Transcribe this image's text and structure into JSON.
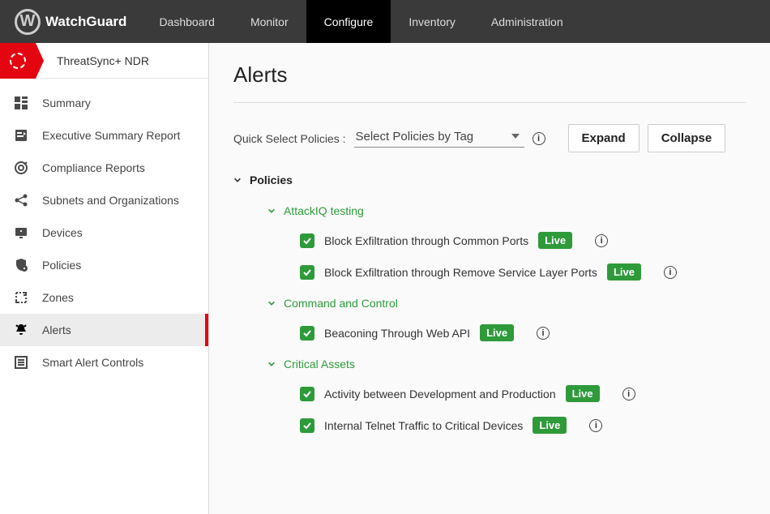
{
  "brand": "WatchGuard",
  "nav": {
    "items": [
      {
        "label": "Dashboard",
        "active": false
      },
      {
        "label": "Monitor",
        "active": false
      },
      {
        "label": "Configure",
        "active": true
      },
      {
        "label": "Inventory",
        "active": false
      },
      {
        "label": "Administration",
        "active": false
      }
    ]
  },
  "sidebar": {
    "module": "ThreatSync+ NDR",
    "items": [
      {
        "label": "Summary",
        "icon": "grid-icon",
        "active": false
      },
      {
        "label": "Executive Summary Report",
        "icon": "report-icon",
        "active": false
      },
      {
        "label": "Compliance Reports",
        "icon": "target-icon",
        "active": false
      },
      {
        "label": "Subnets and Organizations",
        "icon": "share-icon",
        "active": false
      },
      {
        "label": "Devices",
        "icon": "monitor-plus-icon",
        "active": false
      },
      {
        "label": "Policies",
        "icon": "shield-icon",
        "active": false
      },
      {
        "label": "Zones",
        "icon": "zone-icon",
        "active": false
      },
      {
        "label": "Alerts",
        "icon": "bell-icon",
        "active": true
      },
      {
        "label": "Smart Alert Controls",
        "icon": "list-icon",
        "active": false
      }
    ]
  },
  "main": {
    "title": "Alerts",
    "quick_label": "Quick Select Policies :",
    "select_placeholder": "Select Policies by Tag",
    "expand_label": "Expand",
    "collapse_label": "Collapse",
    "section_title": "Policies",
    "live_badge": "Live",
    "info_char": "i",
    "groups": [
      {
        "name": "AttackIQ testing",
        "policies": [
          {
            "label": "Block Exfiltration through Common Ports",
            "checked": true,
            "live": true
          },
          {
            "label": "Block Exfiltration through Remove Service Layer Ports",
            "checked": true,
            "live": true
          }
        ]
      },
      {
        "name": "Command and Control",
        "policies": [
          {
            "label": "Beaconing Through Web API",
            "checked": true,
            "live": true
          }
        ]
      },
      {
        "name": "Critical Assets",
        "policies": [
          {
            "label": "Activity between Development and Production",
            "checked": true,
            "live": true
          },
          {
            "label": "Internal Telnet Traffic to Critical Devices",
            "checked": true,
            "live": true
          }
        ]
      }
    ]
  }
}
